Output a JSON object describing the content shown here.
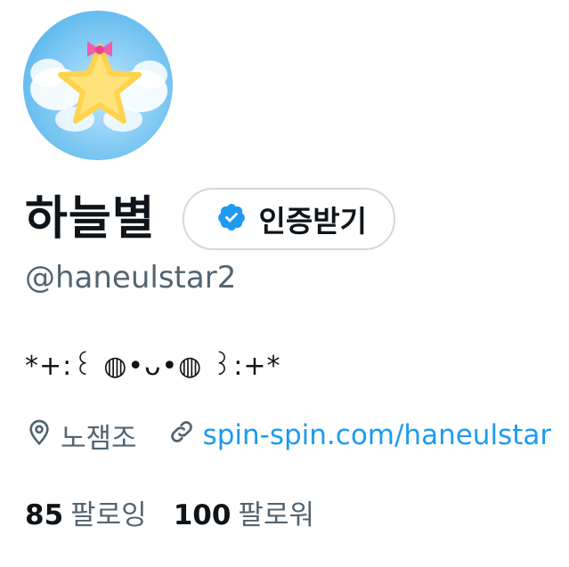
{
  "profile": {
    "display_name": "하늘별",
    "verify_button_label": "인증받기",
    "handle": "@haneulstar2",
    "bio": "*+:꒰ ◍•ᴗ•◍ ꒱:+*",
    "location": "노잼조",
    "website": "spin-spin.com/haneulstar"
  },
  "stats": {
    "following_count": "85",
    "following_label": "팔로잉",
    "followers_count": "100",
    "followers_label": "팔로워"
  },
  "icons": {
    "avatar_image": "yellow-star-with-wings-avatar",
    "verified_badge": "verified-badge-icon",
    "location": "location-pin-icon",
    "link": "link-icon"
  },
  "colors": {
    "accent": "#1d9bf0",
    "text_primary": "#0f1419",
    "text_secondary": "#536471",
    "border": "#cfd9de"
  }
}
